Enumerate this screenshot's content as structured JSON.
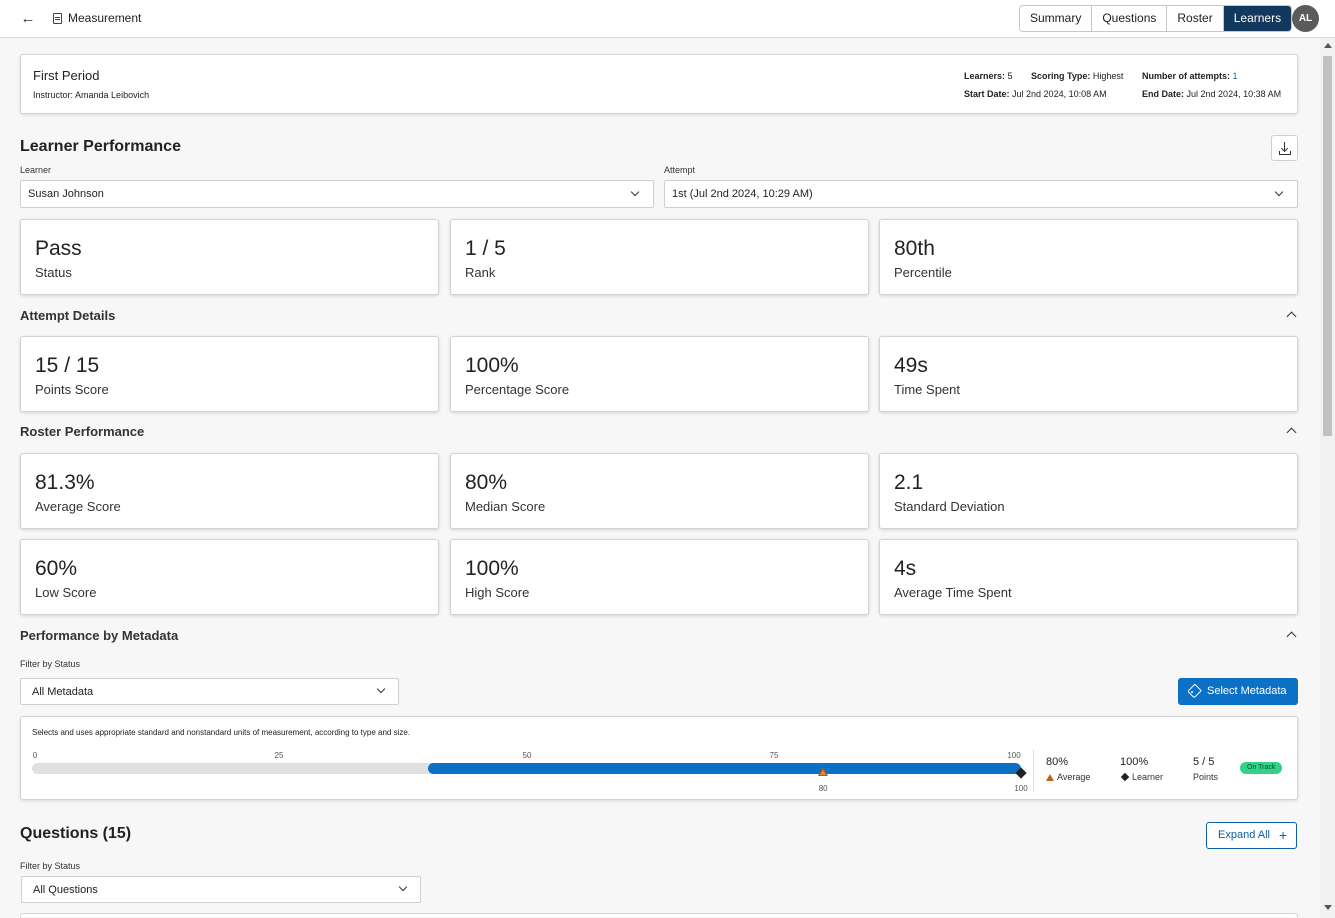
{
  "header": {
    "title": "Measurement",
    "tabs": [
      "Summary",
      "Questions",
      "Roster",
      "Learners"
    ],
    "active_tab": "Learners",
    "avatar": "AL"
  },
  "info": {
    "period": "First Period",
    "instructor_label": "Instructor:",
    "instructor": "Amanda Leibovich",
    "learners_label": "Learners:",
    "learners": "5",
    "scoring_label": "Scoring Type:",
    "scoring": "Highest",
    "attempts_label": "Number of attempts:",
    "attempts": "1",
    "start_label": "Start Date:",
    "start": "Jul 2nd 2024, 10:08 AM",
    "end_label": "End Date:",
    "end": "Jul 2nd 2024, 10:38 AM"
  },
  "learner_performance": {
    "title": "Learner Performance",
    "learner_label": "Learner",
    "learner_value": "Susan Johnson",
    "attempt_label": "Attempt",
    "attempt_value": "1st (Jul 2nd 2024, 10:29 AM)",
    "stats": [
      {
        "value": "Pass",
        "label": "Status"
      },
      {
        "value": "1 / 5",
        "label": "Rank"
      },
      {
        "value": "80th",
        "label": "Percentile"
      }
    ]
  },
  "attempt_details": {
    "title": "Attempt Details",
    "stats": [
      {
        "value": "15 / 15",
        "label": "Points Score"
      },
      {
        "value": "100%",
        "label": "Percentage Score"
      },
      {
        "value": "49s",
        "label": "Time Spent"
      }
    ]
  },
  "roster_performance": {
    "title": "Roster Performance",
    "stats": [
      {
        "value": "81.3%",
        "label": "Average Score"
      },
      {
        "value": "80%",
        "label": "Median Score"
      },
      {
        "value": "2.1",
        "label": "Standard Deviation"
      },
      {
        "value": "60%",
        "label": "Low Score"
      },
      {
        "value": "100%",
        "label": "High Score"
      },
      {
        "value": "4s",
        "label": "Average Time Spent"
      }
    ]
  },
  "metadata": {
    "title": "Performance by Metadata",
    "filter_label": "Filter by Status",
    "filter_value": "All Metadata",
    "select_button": "Select Metadata",
    "item": {
      "description": "Selects and uses appropriate standard and nonstandard units of measurement, according to type and size.",
      "ticks": [
        "0",
        "25",
        "50",
        "75",
        "100"
      ],
      "range_low": 40,
      "range_high": 100,
      "average_marker": 80,
      "learner_marker": 100,
      "average_marker_label": "80",
      "learner_marker_label": "100",
      "average_value": "80%",
      "average_label": "Average",
      "learner_value": "100%",
      "learner_label": "Learner",
      "points_value": "5 / 5",
      "points_label": "Points",
      "status_badge": "On Track",
      "colors": {
        "fill": "#0b71c6",
        "average": "#c0601c",
        "badge": "#2fd18b"
      }
    }
  },
  "questions": {
    "title": "Questions (15)",
    "expand_button": "Expand All",
    "filter_label": "Filter by Status",
    "filter_value": "All Questions"
  }
}
